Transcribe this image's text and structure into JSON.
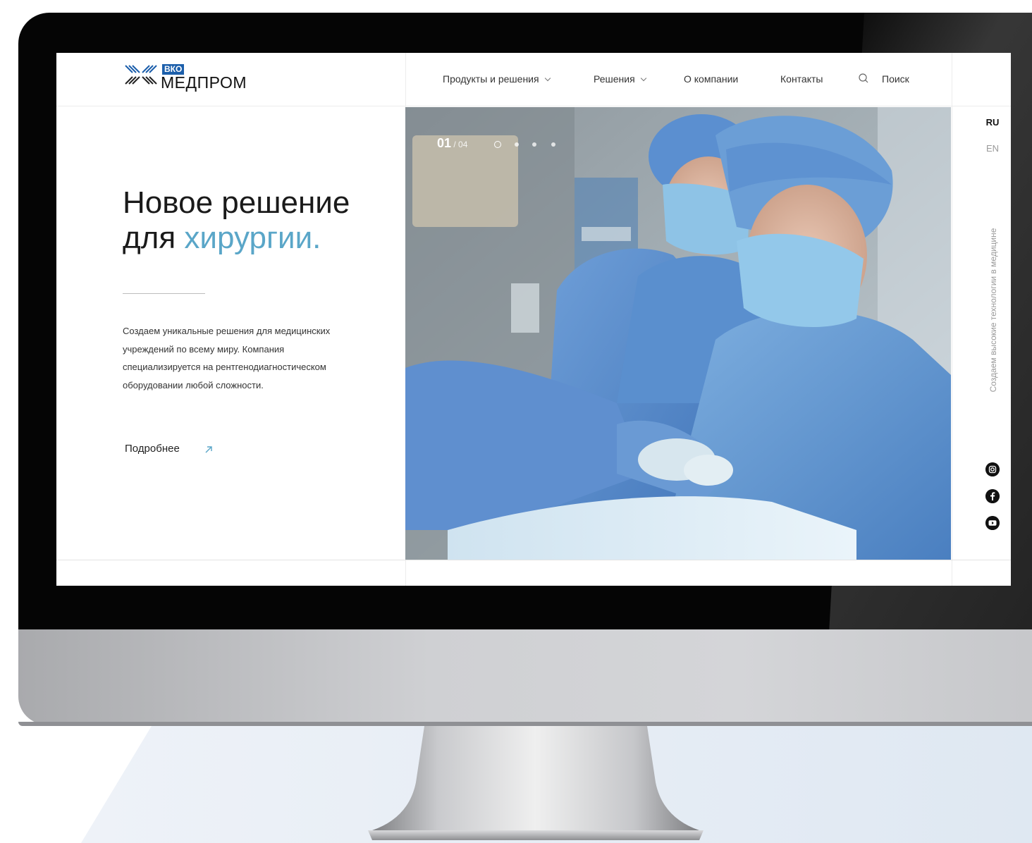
{
  "brand": {
    "badge": "ВКО",
    "name": "МЕДПРОМ"
  },
  "nav": {
    "items": [
      {
        "label": "Продукты и решения",
        "has_dropdown": true
      },
      {
        "label": "Решения",
        "has_dropdown": true
      },
      {
        "label": "О компании",
        "has_dropdown": false
      },
      {
        "label": "Контакты",
        "has_dropdown": false
      }
    ],
    "search_label": "Поиск"
  },
  "hero": {
    "title_line1": "Новое решение",
    "title_line2_prefix": "для ",
    "title_line2_accent": "хирургии.",
    "description": "Создаем уникальные решения для медицинских учреждений по всему миру. Компания специализируется на рентгенодиагностическом оборудовании любой сложности.",
    "more_label": "Подробнее"
  },
  "slider": {
    "current": "01",
    "separator": " / ",
    "total": "04",
    "active_index": 0,
    "count": 4
  },
  "languages": {
    "active": "RU",
    "other": "EN"
  },
  "side_tagline": "Создаем высокие технологии в медицине",
  "social": [
    "instagram-icon",
    "facebook-icon",
    "youtube-icon"
  ],
  "colors": {
    "accent": "#5aa6c8",
    "brand_blue": "#1c5fab",
    "scrub_blue": "#5b8fd0"
  }
}
